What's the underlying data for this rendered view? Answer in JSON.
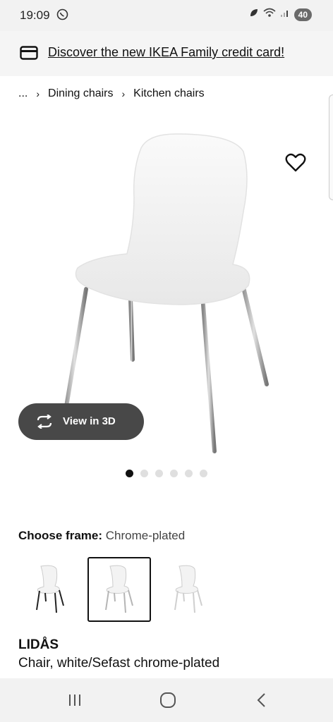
{
  "status_bar": {
    "time": "19:09",
    "battery": "40"
  },
  "promo": {
    "link_text": "Discover the new IKEA Family credit card!"
  },
  "breadcrumb": {
    "ellipsis": "...",
    "items": [
      "Dining chairs",
      "Kitchen chairs"
    ]
  },
  "gallery": {
    "view3d_label": "View in 3D",
    "slide_count": 6,
    "active_slide": 1
  },
  "frame": {
    "label": "Choose frame:",
    "value": "Chrome-plated",
    "options_count": 3,
    "selected_index": 1
  },
  "product": {
    "name": "LIDÅS",
    "description": "Chair, white/Sefast chrome-plated"
  },
  "colors": {
    "accent_dark": "#111111",
    "button_bg": "#484848"
  }
}
